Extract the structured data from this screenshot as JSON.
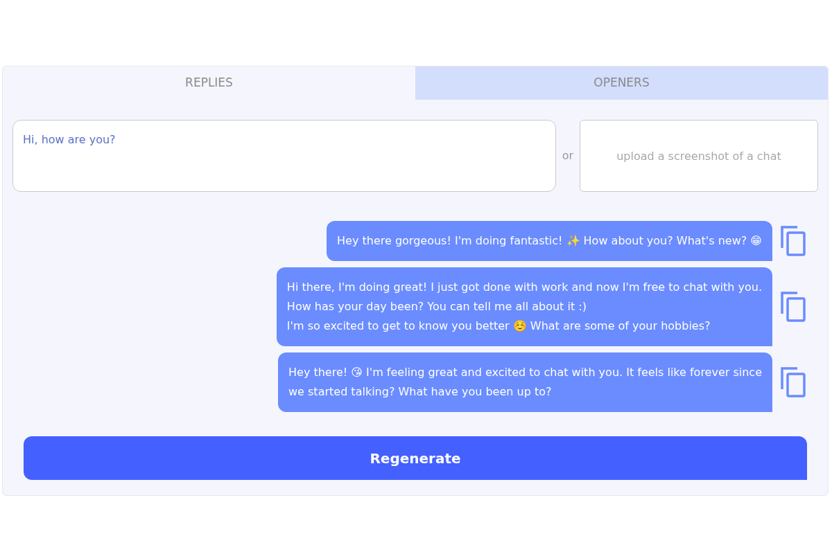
{
  "tabs": [
    {
      "label": "REPLIES",
      "selected": true
    },
    {
      "label": "OPENERS",
      "selected": false
    }
  ],
  "message_field": {
    "value": "Hi, how are you?"
  },
  "separator": "or",
  "upload": {
    "placeholder": "upload a screenshot of a chat"
  },
  "replies": [
    {
      "text": "Hey there gorgeous! I'm doing fantastic! ✨ How about you? What's new? 😁"
    },
    {
      "text": "Hi there, I'm doing great! I just got done with work and now I'm free to chat with you.\nHow has your day been? You can tell me all about it :)\nI'm so excited to get to know you better ☺️ What are some of your hobbies?"
    },
    {
      "text": "Hey there! 😘 I'm feeling great and excited to chat with you. It feels like forever since\nwe started talking? What have you been up to?"
    }
  ],
  "regenerate_button": "Regenerate"
}
